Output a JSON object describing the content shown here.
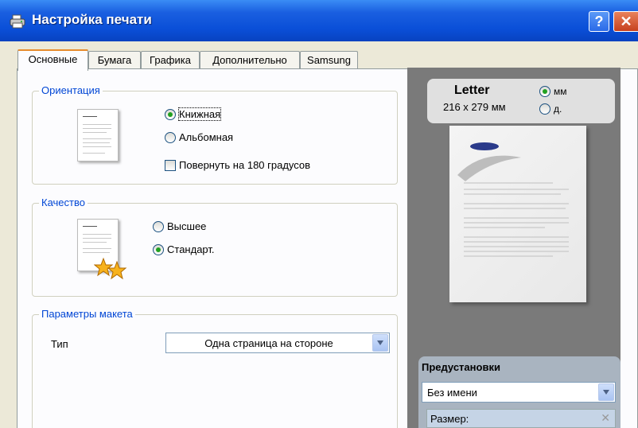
{
  "window": {
    "title": "Настройка печати",
    "help_label": "?",
    "close_label": "✕"
  },
  "tabs": [
    "Основные",
    "Бумага",
    "Графика",
    "Дополнительно",
    "Samsung"
  ],
  "orientation": {
    "title": "Ориентация",
    "options": [
      "Книжная",
      "Альбомная"
    ],
    "selected": 0,
    "rotate_label": "Повернуть на 180 градусов",
    "rotate_checked": false
  },
  "quality": {
    "title": "Качество",
    "options": [
      "Высшее",
      "Стандарт."
    ],
    "selected": 1
  },
  "layout": {
    "title": "Параметры макета",
    "type_label": "Тип",
    "type_value": "Одна страница на стороне"
  },
  "preview": {
    "paper_name": "Letter",
    "paper_size": "216 x 279 мм",
    "unit_mm": "мм",
    "unit_inch": "д.",
    "unit_selected": "mm"
  },
  "presets": {
    "title": "Предустановки",
    "value": "Без имени",
    "size_label": "Размер:"
  },
  "colors": {
    "title_bar": "#0a4fd8",
    "group_title": "#0046d5",
    "preview_bg": "#7a7a7a",
    "tab_accent": "#e68b2c"
  }
}
